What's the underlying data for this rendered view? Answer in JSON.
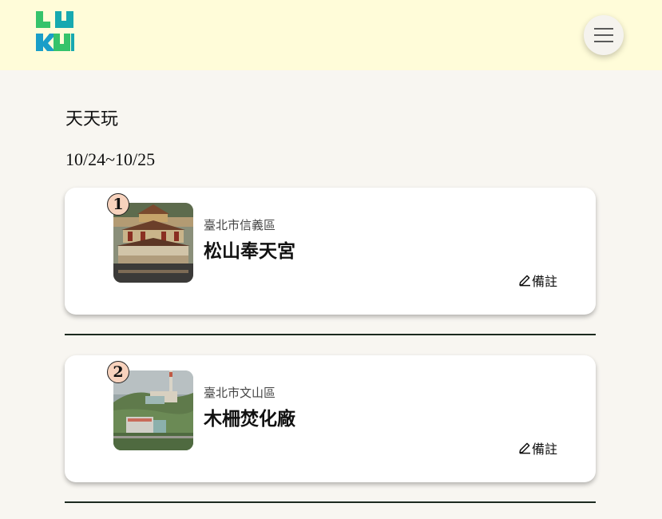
{
  "header": {
    "logo_text": "LUKUI",
    "menu_icon": "hamburger-icon"
  },
  "trip": {
    "title": "天天玩",
    "date_range": "10/24~10/25"
  },
  "stops": [
    {
      "number": "1",
      "district": "臺北市信義區",
      "name": "松山奉天宮",
      "note_label": "備註"
    },
    {
      "number": "2",
      "district": "臺北市文山區",
      "name": "木柵焚化廠",
      "note_label": "備註"
    }
  ],
  "colors": {
    "header_bg": "#fffcd9",
    "page_bg": "#f8f6f1",
    "badge_bg": "#f7d2bd",
    "divider": "#1c2a1f"
  }
}
